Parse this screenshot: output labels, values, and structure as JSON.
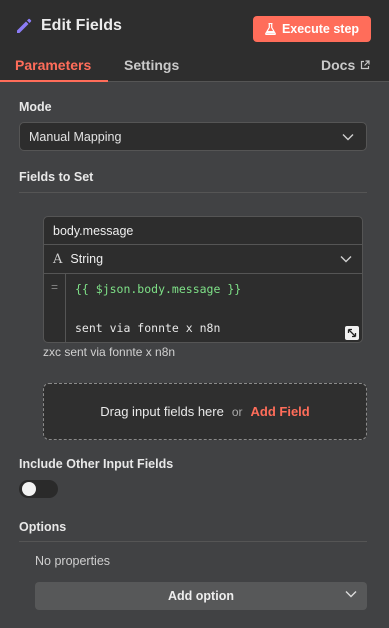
{
  "header": {
    "title": "Edit Fields",
    "execute_label": "Execute step",
    "tabs": [
      {
        "label": "Parameters",
        "active": true
      },
      {
        "label": "Settings",
        "active": false
      },
      {
        "label": "Docs",
        "active": false
      }
    ]
  },
  "mode": {
    "label": "Mode",
    "value": "Manual Mapping"
  },
  "fields": {
    "label": "Fields to Set",
    "items": [
      {
        "name": "body.message",
        "type_icon": "A",
        "type": "String",
        "gutter": "=",
        "expression_line1": "{{ $json.body.message }}",
        "expression_line2": "sent via fonnte x n8n",
        "preview": "zxc sent via fonnte x n8n"
      }
    ]
  },
  "drop_zone": {
    "text": "Drag input fields here",
    "or": "or",
    "add_field": "Add Field"
  },
  "include_other": {
    "label": "Include Other Input Fields",
    "enabled": false
  },
  "options": {
    "label": "Options",
    "empty_text": "No properties",
    "add_option_label": "Add option"
  },
  "colors": {
    "accent": "#ff6d5a",
    "pencil": "#8b7cf6",
    "expression_green": "#7ee087",
    "background": "#414244",
    "header_bg": "#2e2e2e"
  }
}
